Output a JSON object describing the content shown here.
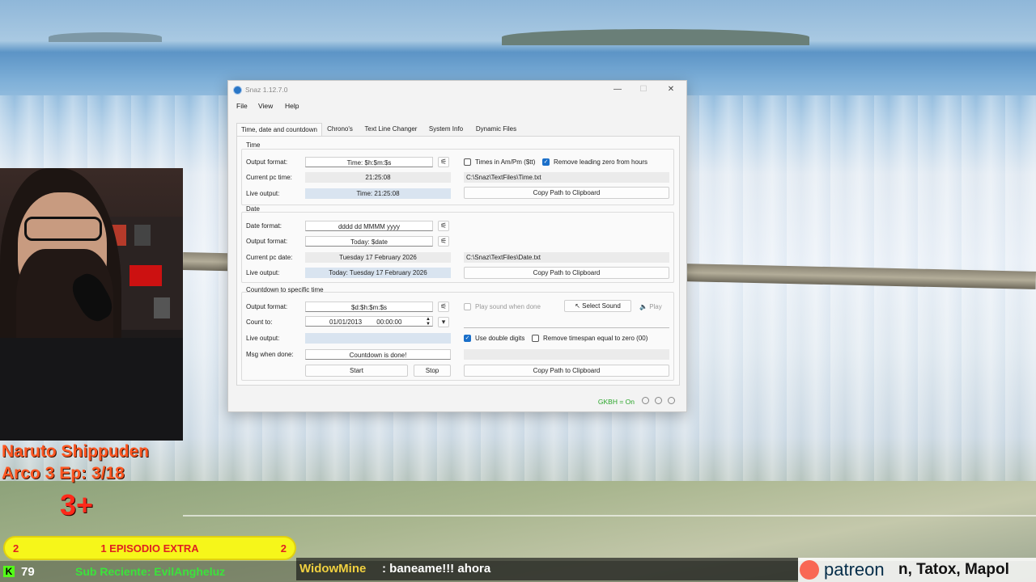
{
  "window": {
    "title": "Snaz 1.12.7.0",
    "controls": {
      "minimize": "—",
      "maximize": "☐",
      "close": "✕"
    }
  },
  "menubar": [
    "File",
    "View",
    "Help"
  ],
  "tabs": [
    "Time, date and countdown",
    "Chrono's",
    "Text Line Changer",
    "System Info",
    "Dynamic Files"
  ],
  "active_tab": "Time, date and countdown",
  "time": {
    "group_title": "Time",
    "output_format_label": "Output format:",
    "output_format_value": "Time: $h:$m:$s",
    "current_label": "Current pc time:",
    "current_value": "21:25:08",
    "live_label": "Live output:",
    "live_value": "Time: 21:25:08",
    "ampm_label": "Times in Am/Pm ($tt)",
    "ampm_checked": false,
    "remove_zero_label": "Remove leading zero from hours",
    "remove_zero_checked": true,
    "file_path": "C:\\Snaz\\TextFiles\\Time.txt",
    "copy_label": "Copy Path to Clipboard"
  },
  "date": {
    "group_title": "Date",
    "date_format_label": "Date format:",
    "date_format_value": "dddd dd MMMM yyyy",
    "output_format_label": "Output format:",
    "output_format_value": "Today: $date",
    "current_label": "Current pc date:",
    "current_value": "Tuesday 17 February 2026",
    "live_label": "Live output:",
    "live_value": "Today: Tuesday 17 February 2026",
    "file_path": "C:\\Snaz\\TextFiles\\Date.txt",
    "copy_label": "Copy Path to Clipboard"
  },
  "countdown": {
    "group_title": "Countdown to specific time",
    "output_format_label": "Output format:",
    "output_format_value": "$d:$h:$m:$s",
    "count_to_label": "Count to:",
    "count_to_date": "01/01/2013",
    "count_to_time": "00:00:00",
    "live_label": "Live output:",
    "live_value": "",
    "msg_label": "Msg when done:",
    "msg_value": "Countdown is done!",
    "start_label": "Start",
    "stop_label": "Stop",
    "play_sound_label": "Play sound when done",
    "play_sound_checked": false,
    "select_sound_label": "Select Sound",
    "play_label": "Play",
    "double_digits_label": "Use double digits",
    "double_digits_checked": true,
    "remove_timespan_label": "Remove timespan equal to zero (00)",
    "remove_timespan_checked": false,
    "copy_label": "Copy Path to Clipboard"
  },
  "statusbar": {
    "hotkeys": "GKBH = On"
  },
  "overlay": {
    "show_title": "Naruto Shippuden",
    "arc": "Arco 3 Ep: 3/18",
    "big": "3+",
    "extra_left": "2",
    "extra_center": "1 EPISODIO EXTRA",
    "extra_right": "2",
    "kick_logo": "K",
    "kick_count": "79",
    "sub_reciente": "Sub Reciente: EvilAngheluz",
    "chat_user": "WidowMine",
    "chat_message": ": baneame!!! ahora",
    "patreon": "patreon",
    "patreon_names": "n, Tatox, Mapol"
  },
  "colors": {
    "accent": "#1a6fc9",
    "overlay_orange": "#ff5722",
    "status_green": "#2aa52a",
    "extra_yellow": "#f6f61a"
  }
}
